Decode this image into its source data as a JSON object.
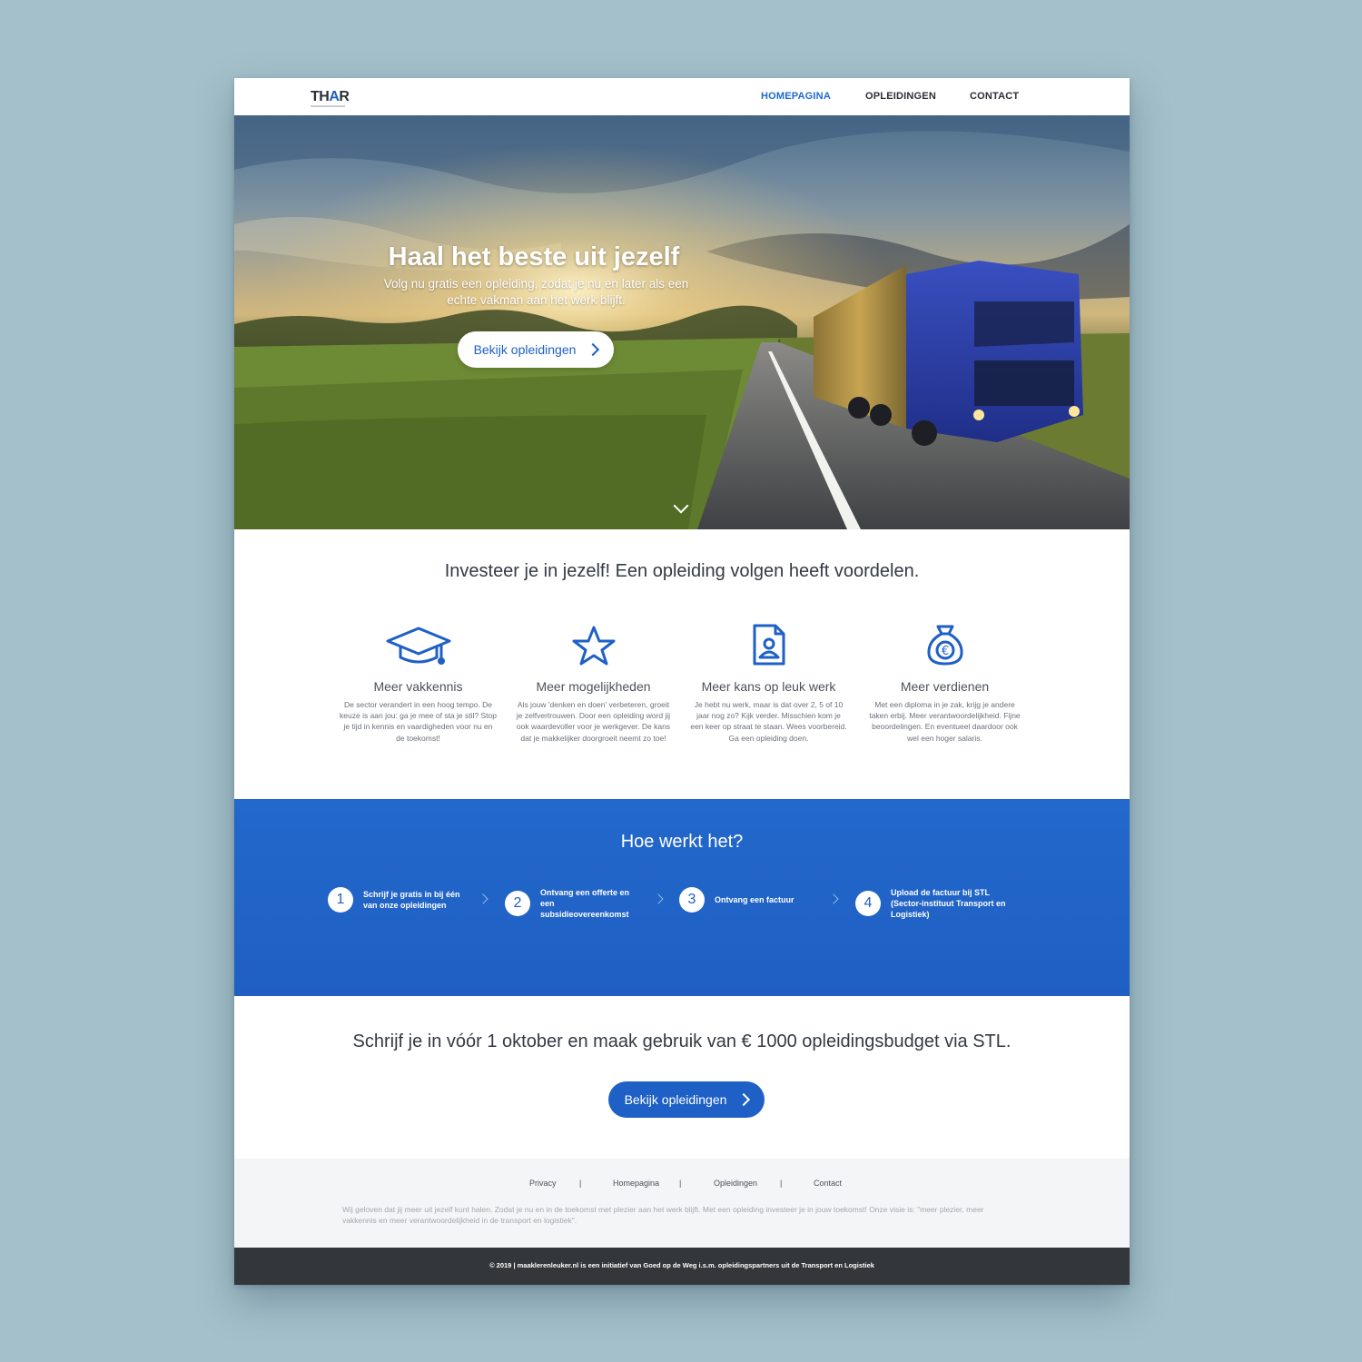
{
  "brand": {
    "logo_prefix": "TH",
    "logo_accent": "A",
    "logo_suffix": "R"
  },
  "nav": {
    "items": [
      "HOMEPAGINA",
      "OPLEIDINGEN",
      "CONTACT"
    ],
    "active": "HOMEPAGINA"
  },
  "hero": {
    "title": "Haal het beste uit jezelf",
    "subtitle": "Volg nu gratis een opleiding, zodat je nu en later als een echte vakman aan het werk blijft.",
    "button": "Bekijk opleidingen"
  },
  "benefits": {
    "title": "Investeer je in jezelf! Een opleiding volgen heeft voordelen.",
    "items": [
      {
        "icon": "graduation-cap-icon",
        "title": "Meer vakkennis",
        "text": "De sector verandert in een hoog tempo. De keuze is aan jou: ga je mee of sta je stil? Stop je tijd in kennis en vaardigheden voor nu en de toekomst!"
      },
      {
        "icon": "star-icon",
        "title": "Meer mogelijkheden",
        "text": "Als jouw 'denken en doen' verbeteren, groeit je zelfvertrouwen. Door een opleiding word jij ook waardevoller voor je werkgever. De kans dat je makkelijker doorgroeit neemt zo toe!"
      },
      {
        "icon": "id-document-icon",
        "title": "Meer kans op leuk werk",
        "text": "Je hebt nu werk, maar is dat over 2, 5 of 10 jaar nog zo? Kijk verder. Misschien kom je een keer op straat te staan. Wees voorbereid. Ga een opleiding doen."
      },
      {
        "icon": "euro-money-bag-icon",
        "title": "Meer verdienen",
        "text": "Met een diploma in je zak, krijg je andere taken erbij. Meer verantwoordelijkheid. Fijne beoordelingen. En eventueel daardoor ook wel een hoger salaris."
      }
    ]
  },
  "how": {
    "title": "Hoe werkt het?",
    "steps": [
      {
        "num": "1",
        "text": "Schrijf je gratis in bij één van onze opleidingen"
      },
      {
        "num": "2",
        "text": "Ontvang een offerte en een subsidieovereenkomst"
      },
      {
        "num": "3",
        "text": "Ontvang een factuur"
      },
      {
        "num": "4",
        "text": "Upload de factuur bij STL (Sector-instituut Transport en Logistiek)"
      }
    ]
  },
  "cta": {
    "title": "Schrijf je in vóór 1 oktober en maak gebruik van € 1000 opleidingsbudget via STL.",
    "button": "Bekijk opleidingen"
  },
  "footer": {
    "links": [
      "Privacy",
      "Homepagina",
      "Opleidingen",
      "Contact"
    ],
    "separator": "|",
    "text": "Wij geloven dat jij meer uit jezelf kunt halen. Zodat je nu en in de toekomst met plezier aan het werk blijft. Met een opleiding investeer je in jouw toekomst! Onze visie is: \"meer plezier, meer vakkennis en meer verantwoordelijkheid in de transport en logistiek\".",
    "copyright": "© 2019 | maaklerenleuker.nl is een initiatief van Goed op de Weg i.s.m. opleidingspartners uit de Transport en Logistiek"
  },
  "colors": {
    "accent": "#1f60c6",
    "background": "#a4c0ca",
    "bottombar": "#33363a"
  }
}
